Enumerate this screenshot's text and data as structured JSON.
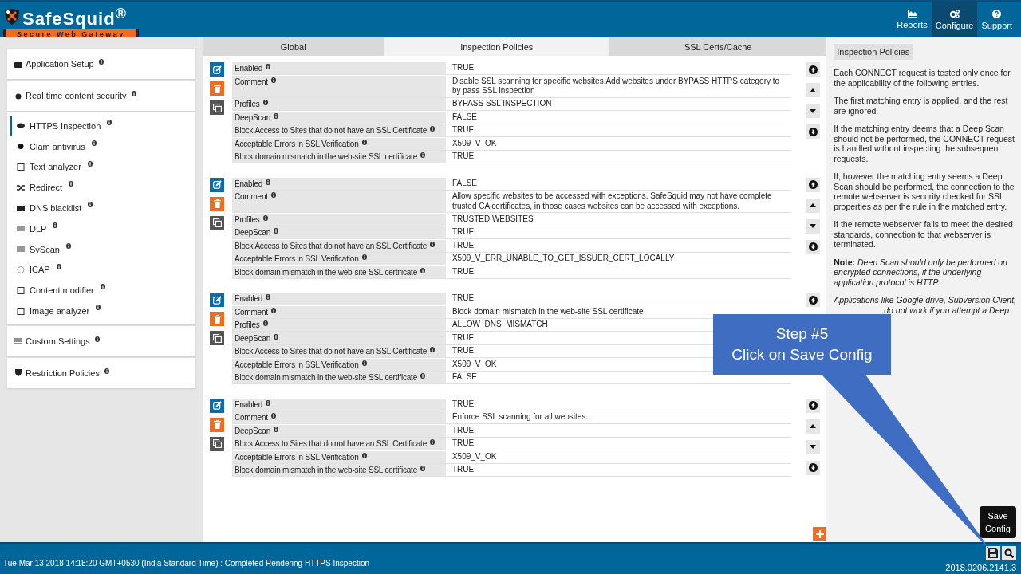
{
  "header": {
    "logo": "SafeSquid$^{®}$",
    "tagline": "Secure Web Gateway",
    "nav": [
      {
        "label": "Reports",
        "selected": false
      },
      {
        "label": "Configure",
        "selected": true
      },
      {
        "label": "Support",
        "selected": false
      }
    ]
  },
  "sidebar": {
    "groups": [
      {
        "label": "Application Setup"
      },
      {
        "label": "Real time content security",
        "children": [
          {
            "label": "HTTPS Inspection",
            "selected": true
          },
          {
            "label": "Clam antivirus",
            "selected": false
          },
          {
            "label": "Text analyzer",
            "selected": false
          },
          {
            "label": "Redirect",
            "selected": false
          },
          {
            "label": "DNS blacklist",
            "selected": false
          },
          {
            "label": "DLP",
            "selected": false
          },
          {
            "label": "SvScan",
            "selected": false
          },
          {
            "label": "ICAP",
            "selected": false
          },
          {
            "label": "Content modifier",
            "selected": false
          },
          {
            "label": "Image analyzer",
            "selected": false
          }
        ]
      },
      {
        "label": "Custom Settings"
      },
      {
        "label": "Restriction Policies"
      }
    ]
  },
  "tabs": [
    {
      "label": "Global",
      "selected": false
    },
    {
      "label": "Inspection Policies",
      "selected": true
    },
    {
      "label": "SSL Certs/Cache",
      "selected": false
    }
  ],
  "policies": [
    {
      "moves": [
        {
          "kind": "top"
        },
        {
          "kind": "up"
        },
        {
          "kind": "down"
        },
        {
          "kind": "bottom"
        }
      ],
      "rows": [
        {
          "label": "Enabled",
          "value": "TRUE"
        },
        {
          "label": "Comment",
          "value": "Disable SSL scanning for specific websites.Add websites under BYPASS HTTPS category to by pass SSL inspection"
        },
        {
          "label": "Profiles",
          "value": "BYPASS SSL INSPECTION"
        },
        {
          "label": "DeepScan",
          "value": "FALSE"
        },
        {
          "label": "Block Access to Sites that do not have an SSL Certificate",
          "value": "TRUE"
        },
        {
          "label": "Acceptable Errors in SSL Verification",
          "value": "X509_V_OK"
        },
        {
          "label": "Block domain mismatch in the web-site SSL certificate",
          "value": "TRUE"
        }
      ]
    },
    {
      "moves": [
        {
          "kind": "top"
        },
        {
          "kind": "up"
        },
        {
          "kind": "down"
        },
        {
          "kind": "bottom"
        }
      ],
      "rows": [
        {
          "label": "Enabled",
          "value": "FALSE"
        },
        {
          "label": "Comment",
          "value": "Allow specific websites to be accessed with exceptions. SafeSquid may not have complete trusted CA certificates, in those cases websites can be accessed with exceptions."
        },
        {
          "label": "Profiles",
          "value": "TRUSTED WEBSITES"
        },
        {
          "label": "DeepScan",
          "value": "TRUE"
        },
        {
          "label": "Block Access to Sites that do not have an SSL Certificate",
          "value": "TRUE"
        },
        {
          "label": "Acceptable Errors in SSL Verification",
          "value": "X509_V_ERR_UNABLE_TO_GET_ISSUER_CERT_LOCALLY"
        },
        {
          "label": "Block domain mismatch in the web-site SSL certificate",
          "value": "TRUE"
        }
      ]
    },
    {
      "moves": [
        {
          "kind": "top"
        }
      ],
      "rows": [
        {
          "label": "Enabled",
          "value": "TRUE"
        },
        {
          "label": "Comment",
          "value": " Block domain mismatch in the web-site SSL certificate"
        },
        {
          "label": "Profiles",
          "value": "ALLOW_DNS_MISMATCH"
        },
        {
          "label": "DeepScan",
          "value": "TRUE"
        },
        {
          "label": "Block Access to Sites that do not have an SSL Certificate",
          "value": "TRUE"
        },
        {
          "label": "Acceptable Errors in SSL Verification",
          "value": "X509_V_OK"
        },
        {
          "label": "Block domain mismatch in the web-site SSL certificate",
          "value": "FALSE"
        }
      ]
    },
    {
      "moves": [
        {
          "kind": "top"
        },
        {
          "kind": "up"
        },
        {
          "kind": "down"
        },
        {
          "kind": "bottom"
        }
      ],
      "rows": [
        {
          "label": "Enabled",
          "value": "TRUE"
        },
        {
          "label": "Comment",
          "value": "Enforce SSL scanning for all websites."
        },
        {
          "label": "DeepScan",
          "value": "TRUE"
        },
        {
          "label": "Block Access to Sites that do not have an SSL Certificate",
          "value": "TRUE"
        },
        {
          "label": "Acceptable Errors in SSL Verification",
          "value": "X509_V_OK"
        },
        {
          "label": "Block domain mismatch in the web-site SSL certificate",
          "value": "TRUE"
        }
      ]
    }
  ],
  "help": {
    "title": "Inspection Policies",
    "paragraphs": [
      "Each CONNECT request is tested only once for the applicability of the following entries.",
      "The first matching entry is applied, and the rest are ignored.",
      "If the matching entry deems that a Deep Scan should not be performed, the CONNECT request is handled without inspecting the subsequent requests.",
      "If, however the matching entry seems a Deep Scan should be performed, the connection to the remote webserver is security checked for SSL properties as per the rule in the matched entry.",
      "If the remote webserver fails to meet the desired standards, connection to that webserver is terminated.",
      "**Note:** *Deep Scan should only be performed on encrypted connections, if the underlying application protocol is HTTP.*"
    ],
    "partial_lines": [
      "Applications like Google drive, Subversion Client,",
      "do not work if you attempt a Deep"
    ]
  },
  "callout": {
    "title": "Step #5",
    "text": "Click on Save Config"
  },
  "status_bar": {
    "message": "Tue Mar 13 2018 14:18:20 GMT+0530 (India Standard Time) : Completed Rendering HTTPS Inspection",
    "tooltip": "Save Config",
    "version": "2018.0206.2141.3"
  }
}
